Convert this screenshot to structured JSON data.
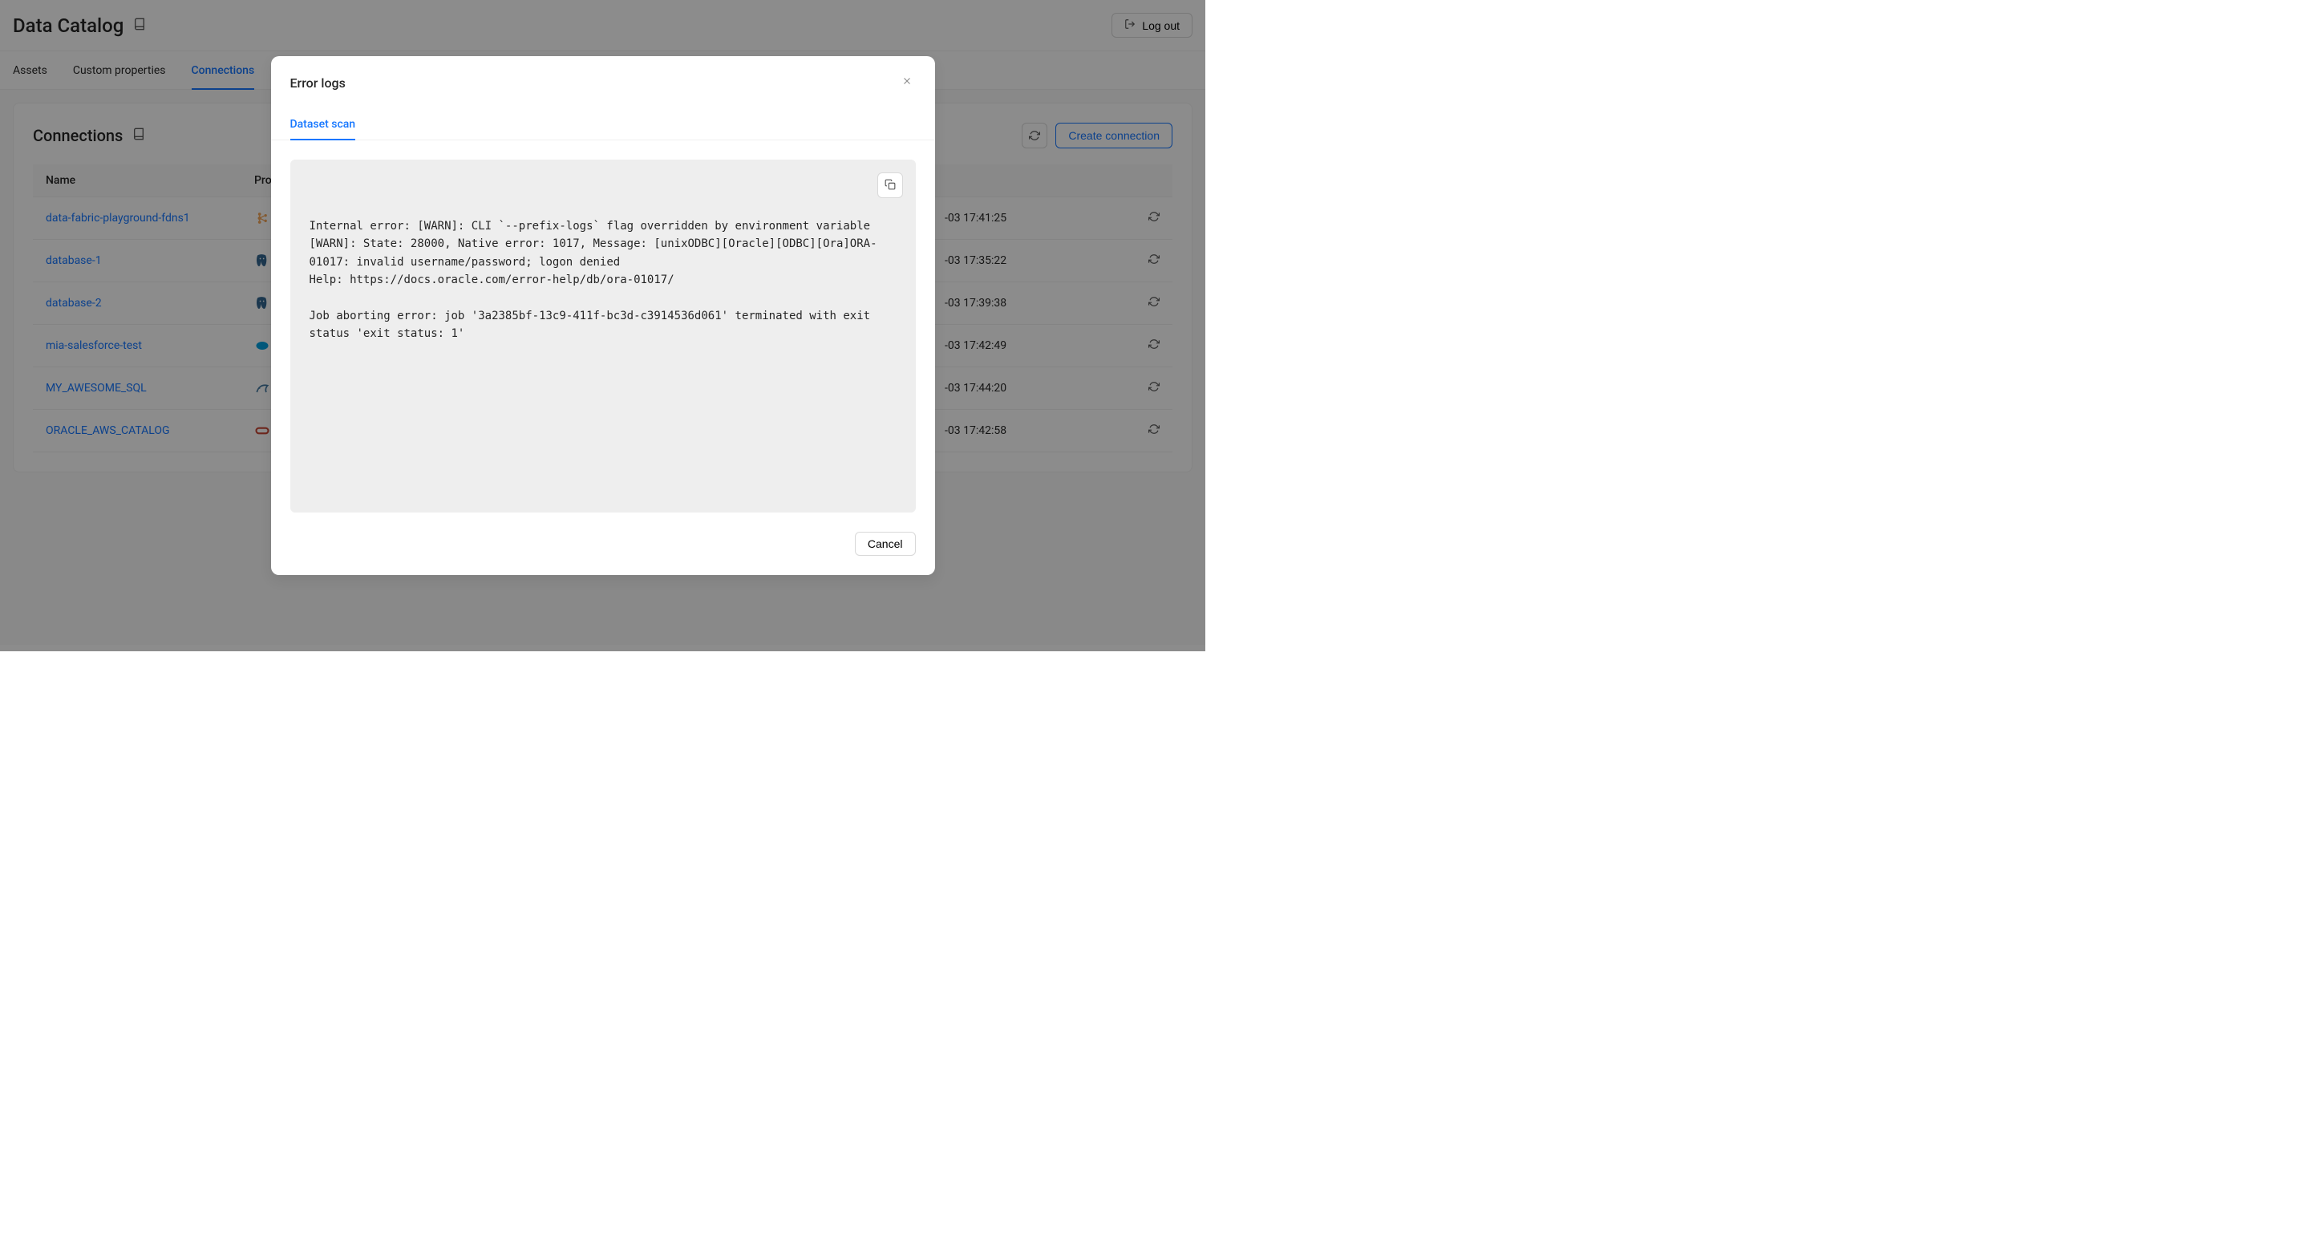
{
  "header": {
    "title": "Data Catalog",
    "logout_label": "Log out"
  },
  "tabs": [
    {
      "label": "Assets",
      "active": false
    },
    {
      "label": "Custom properties",
      "active": false
    },
    {
      "label": "Connections",
      "active": true
    }
  ],
  "panel": {
    "title": "Connections",
    "create_label": "Create connection"
  },
  "table": {
    "columns": {
      "name": "Name",
      "provider": "Pro",
      "time": ""
    },
    "rows": [
      {
        "name": "data-fabric-playground-fdns1",
        "provider": "kafka",
        "time": "-03 17:41:25"
      },
      {
        "name": "database-1",
        "provider": "postgres",
        "time": "-03 17:35:22"
      },
      {
        "name": "database-2",
        "provider": "postgres",
        "time": "-03 17:39:38"
      },
      {
        "name": "mia-salesforce-test",
        "provider": "salesforce",
        "time": "-03 17:42:49"
      },
      {
        "name": "MY_AWESOME_SQL",
        "provider": "mysql",
        "time": "-03 17:44:20"
      },
      {
        "name": "ORACLE_AWS_CATALOG",
        "provider": "oracle",
        "time": "-03 17:42:58"
      }
    ]
  },
  "modal": {
    "title": "Error logs",
    "tab_label": "Dataset scan",
    "log_text": "Internal error: [WARN]: CLI `--prefix-logs` flag overridden by environment variable\n[WARN]: State: 28000, Native error: 1017, Message: [unixODBC][Oracle][ODBC][Ora]ORA-01017: invalid username/password; logon denied\nHelp: https://docs.oracle.com/error-help/db/ora-01017/\n\nJob aborting error: job '3a2385bf-13c9-411f-bc3d-c3914536d061' terminated with exit status 'exit status: 1'",
    "cancel_label": "Cancel"
  },
  "provider_colors": {
    "kafka": "#f2a65a",
    "postgres": "#336791",
    "salesforce": "#00a1e0",
    "mysql": "#4479a1",
    "oracle": "#c74634"
  }
}
